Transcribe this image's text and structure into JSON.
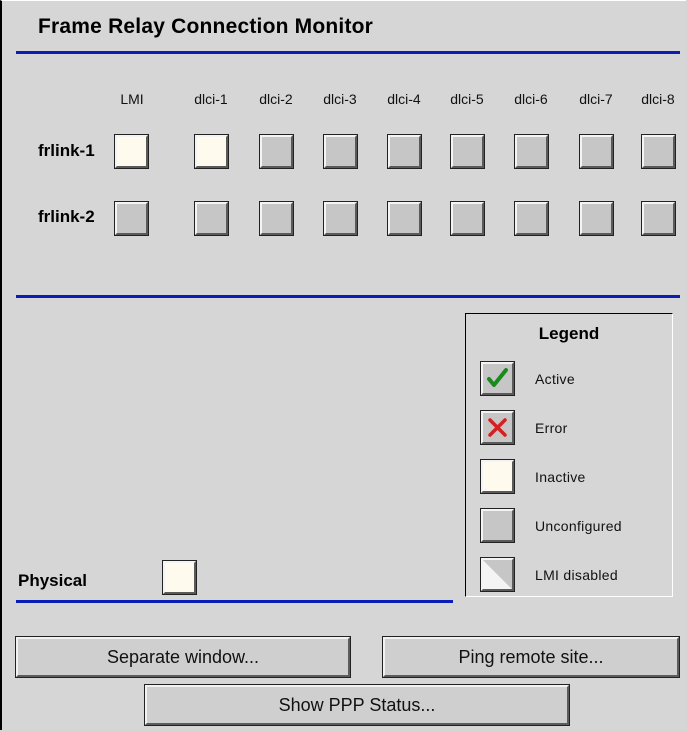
{
  "title": "Frame Relay Connection Monitor",
  "columns": [
    "LMI",
    "dlci-1",
    "dlci-2",
    "dlci-3",
    "dlci-4",
    "dlci-5",
    "dlci-6",
    "dlci-7",
    "dlci-8"
  ],
  "rows": [
    {
      "label": "frlink-1",
      "states": [
        "inactive",
        "inactive",
        "unconfigured",
        "unconfigured",
        "unconfigured",
        "unconfigured",
        "unconfigured",
        "unconfigured",
        "unconfigured"
      ]
    },
    {
      "label": "frlink-2",
      "states": [
        "unconfigured",
        "unconfigured",
        "unconfigured",
        "unconfigured",
        "unconfigured",
        "unconfigured",
        "unconfigured",
        "unconfigured",
        "unconfigured"
      ]
    }
  ],
  "legend": {
    "title": "Legend",
    "items": [
      {
        "label": "Active",
        "icon": "check-icon"
      },
      {
        "label": "Error",
        "icon": "x-icon"
      },
      {
        "label": "Inactive",
        "icon": "inactive-box"
      },
      {
        "label": "Unconfigured",
        "icon": "unconfigured-box"
      },
      {
        "label": "LMI disabled",
        "icon": "lmi-disabled-box"
      }
    ]
  },
  "physical": {
    "label": "Physical",
    "state": "inactive"
  },
  "buttons": {
    "separate_window": "Separate window...",
    "ping_remote": "Ping remote site...",
    "show_ppp": "Show PPP Status..."
  },
  "colors": {
    "divider": "#0a1eb4",
    "inactive": "#fffaee",
    "unconfigured": "#c6c6c6",
    "active_check": "#1a8a1a",
    "error_x": "#d42020"
  }
}
